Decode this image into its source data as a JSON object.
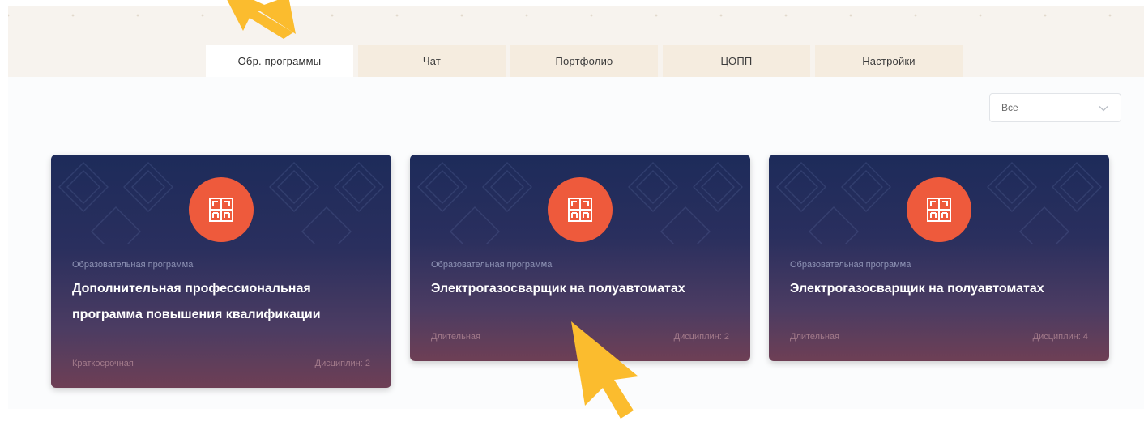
{
  "tabs": [
    {
      "label": "Обр. программы",
      "active": true
    },
    {
      "label": "Чат",
      "active": false
    },
    {
      "label": "Портфолио",
      "active": false
    },
    {
      "label": "ЦОПП",
      "active": false
    },
    {
      "label": "Настройки",
      "active": false
    }
  ],
  "filter": {
    "selected": "Все"
  },
  "cards": [
    {
      "type": "Образовательная программа",
      "title": "Дополнительная профессиональная программа повышения квалификации",
      "duration": "Краткосрочная",
      "disciplines": "Дисциплин: 2"
    },
    {
      "type": "Образовательная программа",
      "title": "Электрогазосварщик на полуавтоматах",
      "duration": "Длительная",
      "disciplines": "Дисциплин: 2"
    },
    {
      "type": "Образовательная программа",
      "title": "Электрогазосварщик на полуавтоматах",
      "duration": "Длительная",
      "disciplines": "Дисциплин: 4"
    }
  ],
  "colors": {
    "accent": "#ee5a3c",
    "cursor": "#fbbc2e",
    "card_top": "#1d2b5a",
    "card_bottom": "#6e3f55"
  }
}
